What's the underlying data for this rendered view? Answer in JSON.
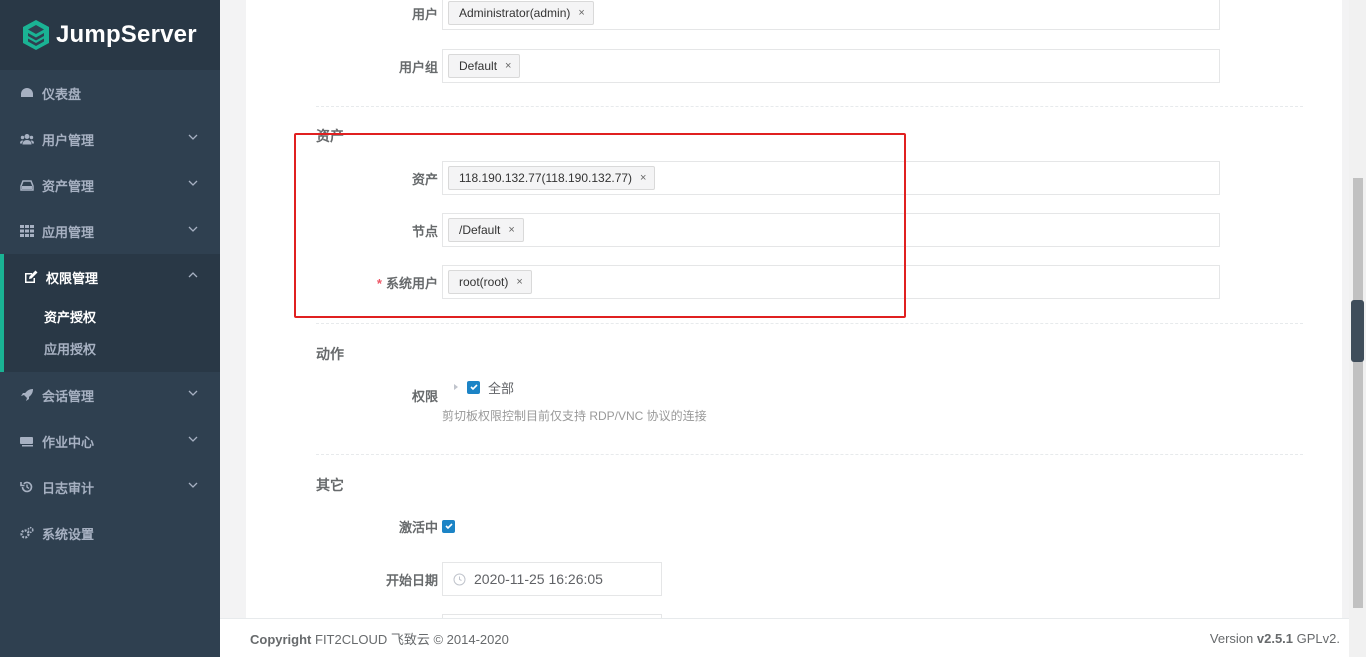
{
  "app": {
    "logo_text": "JumpServer"
  },
  "sidebar": {
    "items": [
      {
        "label": "仪表盘",
        "icon": "dashboard-icon",
        "has_children": false
      },
      {
        "label": "用户管理",
        "icon": "users-icon",
        "has_children": true
      },
      {
        "label": "资产管理",
        "icon": "hdd-icon",
        "has_children": true
      },
      {
        "label": "应用管理",
        "icon": "grid-icon",
        "has_children": true
      },
      {
        "label": "权限管理",
        "icon": "edit-icon",
        "has_children": true,
        "expanded": true
      },
      {
        "label": "会话管理",
        "icon": "rocket-icon",
        "has_children": true
      },
      {
        "label": "作业中心",
        "icon": "keyboard-icon",
        "has_children": true
      },
      {
        "label": "日志审计",
        "icon": "history-icon",
        "has_children": true
      },
      {
        "label": "系统设置",
        "icon": "gears-icon",
        "has_children": false
      }
    ],
    "permission_sub": [
      {
        "label": "资产授权",
        "active": true
      },
      {
        "label": "应用授权",
        "active": false
      }
    ]
  },
  "form": {
    "user": {
      "label": "用户",
      "tags": [
        "Administrator(admin)"
      ]
    },
    "user_group": {
      "label": "用户组",
      "tags": [
        "Default"
      ]
    },
    "asset_section": "资产",
    "assets": {
      "label": "资产",
      "tags": [
        "118.190.132.77(118.190.132.77)"
      ]
    },
    "nodes": {
      "label": "节点",
      "tags": [
        "/Default"
      ]
    },
    "system_users": {
      "label": "系统用户",
      "required_mark": "*",
      "tags": [
        "root(root)"
      ]
    },
    "action_section": "动作",
    "permission": {
      "label": "权限",
      "option": "全部",
      "checked": true,
      "hint": "剪切板权限控制目前仅支持 RDP/VNC 协议的连接"
    },
    "other_section": "其它",
    "active": {
      "label": "激活中",
      "checked": true
    },
    "start_date": {
      "label": "开始日期",
      "value": "2020-11-25 16:26:05"
    }
  },
  "footer": {
    "copyright_bold": "Copyright",
    "copyright_rest": " FIT2CLOUD 飞致云 © 2014-2020",
    "version_prefix": "Version ",
    "version_bold": "v2.5.1",
    "version_suffix": " GPLv2."
  },
  "colors": {
    "sidebar_bg": "#2f4050",
    "accent": "#1ab394",
    "checkbox": "#1c84c6",
    "highlight": "#e02020"
  }
}
